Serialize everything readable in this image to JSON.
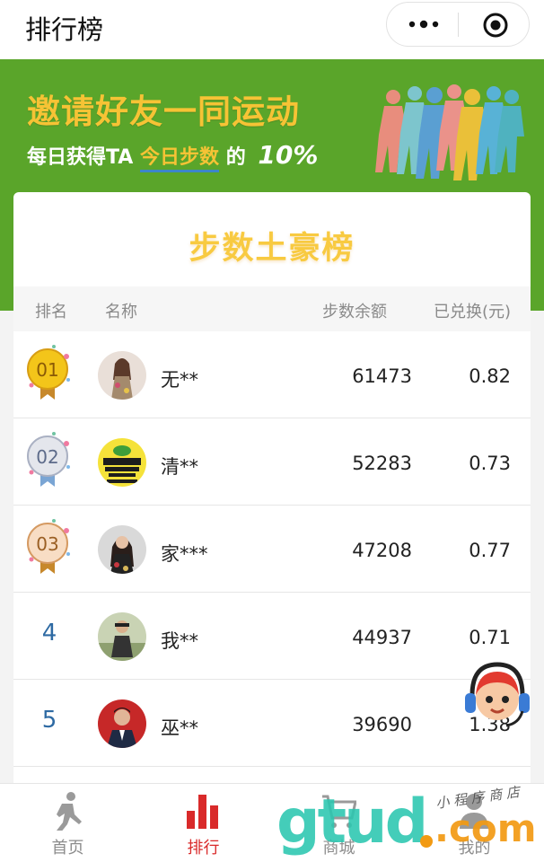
{
  "navbar": {
    "title": "排行榜",
    "more_icon": "more-dots-icon",
    "close_icon": "target-circle-icon"
  },
  "banner": {
    "title": "邀请好友一同运动",
    "subtitle_prefix": "每日获得TA",
    "subtitle_highlight": "今日步数",
    "subtitle_mid": "的",
    "subtitle_percent": "10%"
  },
  "card": {
    "title": "步数土豪榜",
    "columns": {
      "rank": "排名",
      "name": "名称",
      "steps": "步数余额",
      "exchanged": "已兑换(元)"
    },
    "rows": [
      {
        "rank": "01",
        "medal": "gold",
        "name": "无**",
        "steps": "61473",
        "exchanged": "0.82"
      },
      {
        "rank": "02",
        "medal": "silver",
        "name": "清**",
        "steps": "52283",
        "exchanged": "0.73"
      },
      {
        "rank": "03",
        "medal": "bronze",
        "name": "家***",
        "steps": "47208",
        "exchanged": "0.77"
      },
      {
        "rank": "4",
        "medal": "",
        "name": "我**",
        "steps": "44937",
        "exchanged": "0.71"
      },
      {
        "rank": "5",
        "medal": "",
        "name": "巫**",
        "steps": "39690",
        "exchanged": "1.38"
      }
    ]
  },
  "tabs": [
    {
      "label": "首页",
      "icon": "runner-icon",
      "active": false
    },
    {
      "label": "排行",
      "icon": "bar-chart-icon",
      "active": true
    },
    {
      "label": "商城",
      "icon": "shopping-cart-icon",
      "active": false
    },
    {
      "label": "我的",
      "icon": "user-icon",
      "active": false
    }
  ],
  "watermark": {
    "logo": "gtud",
    "suffix": ".com",
    "small_text": "小 程 序 商 店"
  },
  "colors": {
    "banner_green": "#5aa52a",
    "title_yellow": "#f8ca41",
    "active_red": "#d92a2a",
    "rank_blue": "#2e6aa3"
  }
}
